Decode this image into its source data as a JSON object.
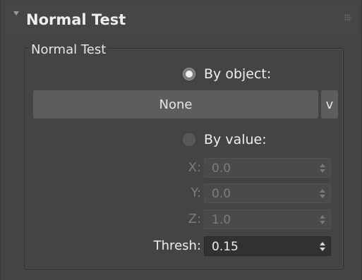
{
  "rollout": {
    "title": "Normal Test",
    "collapse_icon": "triangle-down-icon",
    "grip_icon": "grip-dots-icon"
  },
  "group": {
    "label": "Normal Test"
  },
  "by_object": {
    "label": "By object:",
    "checked": true
  },
  "object_picker": {
    "label": "None",
    "dropdown_label": "v"
  },
  "by_value": {
    "label": "By value:",
    "checked": false
  },
  "fields": {
    "x": {
      "label": "X:",
      "value": "0.0",
      "enabled": false
    },
    "y": {
      "label": "Y:",
      "value": "0.0",
      "enabled": false
    },
    "z": {
      "label": "Z:",
      "value": "1.0",
      "enabled": false
    },
    "thresh": {
      "label": "Thresh:",
      "value": "0.15",
      "enabled": true
    }
  },
  "colors": {
    "panel_background": "#444444",
    "button_background": "#5d5d5d",
    "active_field": "#313131",
    "disabled_text": "#7c7c7c"
  }
}
